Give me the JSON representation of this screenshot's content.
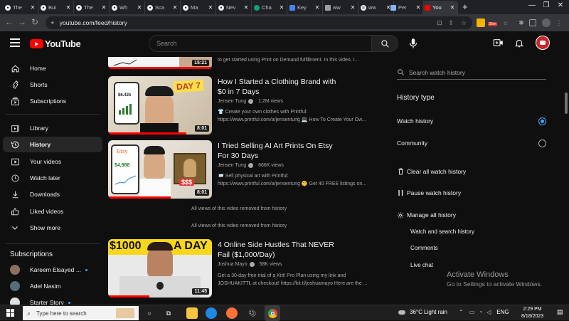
{
  "browser": {
    "tabs": [
      {
        "title": "The"
      },
      {
        "title": "Bui"
      },
      {
        "title": "The"
      },
      {
        "title": "Wh"
      },
      {
        "title": "Sca"
      },
      {
        "title": "Ma"
      },
      {
        "title": "Nev"
      },
      {
        "title": "Cha"
      },
      {
        "title": "Key"
      },
      {
        "title": "ww"
      },
      {
        "title": "ww"
      },
      {
        "title": "Per"
      },
      {
        "title": "You"
      }
    ],
    "url": "youtube.com/feed/history",
    "ext_badge": "35m"
  },
  "header": {
    "logo_text": "YouTube",
    "search_placeholder": "Search"
  },
  "sidebar": {
    "items": [
      {
        "label": "Home"
      },
      {
        "label": "Shorts"
      },
      {
        "label": "Subscriptions"
      },
      {
        "label": "Library"
      },
      {
        "label": "History"
      },
      {
        "label": "Your videos"
      },
      {
        "label": "Watch later"
      },
      {
        "label": "Downloads"
      },
      {
        "label": "Liked videos"
      },
      {
        "label": "Show more"
      }
    ],
    "subscriptions_title": "Subscriptions",
    "subscriptions": [
      {
        "name": "Kareem Elsayed ..."
      },
      {
        "name": "Adel Nasim"
      },
      {
        "name": "Starter Story"
      }
    ]
  },
  "feed": {
    "top_partial": {
      "desc": "to get started using Print on Demand fulfillment. In this video, I...",
      "duration": "15:21"
    },
    "videos": [
      {
        "title": "How I Started a Clothing Brand with $0 in 7 Days",
        "channel": "Jensen Tung",
        "views": "1.2M views",
        "desc1": "👕 Create your own clothes with Printful:",
        "desc2": "https://www.printful.com/a/jensentung 💻 How To Create Your Ow...",
        "duration": "8:01",
        "thumb_text": "DAY 7",
        "thumb_stat": "$6.42k",
        "progress": 0.75
      },
      {
        "title": "I Tried Selling AI Art Prints On Etsy For 30 Days",
        "channel": "Jensen Tung",
        "views": "666K views",
        "desc1": "📨 Sell physical art with Printful:",
        "desc2": "https://www.printful.com/a/jensentung 🤫 Get 40 FREE listings on...",
        "duration": "8:01",
        "thumb_text": "Etsy",
        "thumb_stat": "$4,988",
        "thumb_sss": "$$$",
        "progress": 0.6
      },
      {
        "title": "4 Online Side Hustles That NEVER Fail ($1,000/Day)",
        "channel": "Joshua Mayo",
        "views": "58K views",
        "desc1": "Get a 30-day free trial of a Kitt! Pro Plan using my link and",
        "desc2": "JOSHUAKITTL at checkout! https://kit.tl/joshuamayo Here are the ...",
        "duration": "11:45",
        "thumb_text_left": "$1000",
        "thumb_text_right": "A DAY",
        "progress": 0.4
      }
    ],
    "removed_notes": [
      "All views of this video removed from history",
      "All views of this video removed from history"
    ]
  },
  "panel": {
    "search_placeholder": "Search watch history",
    "history_type_title": "History type",
    "types": [
      {
        "label": "Watch history",
        "selected": true
      },
      {
        "label": "Community",
        "selected": false
      }
    ],
    "actions": [
      {
        "label": "Clear all watch history"
      },
      {
        "label": "Pause watch history"
      },
      {
        "label": "Manage all history"
      }
    ],
    "sublinks": [
      {
        "label": "Watch and search history"
      },
      {
        "label": "Comments"
      },
      {
        "label": "Live chat"
      }
    ]
  },
  "watermark": {
    "line1": "Activate Windows",
    "line2": "Go to Settings to activate Windows."
  },
  "taskbar": {
    "search_placeholder": "Type here to search",
    "weather": "36°C  Light rain",
    "lang": "ENG",
    "time": "2:29 PM",
    "date": "8/18/2023"
  },
  "colors": {
    "accent_red": "#ff0000",
    "selected_blue": "#3ea6ff",
    "background": "#0f0f0f"
  }
}
